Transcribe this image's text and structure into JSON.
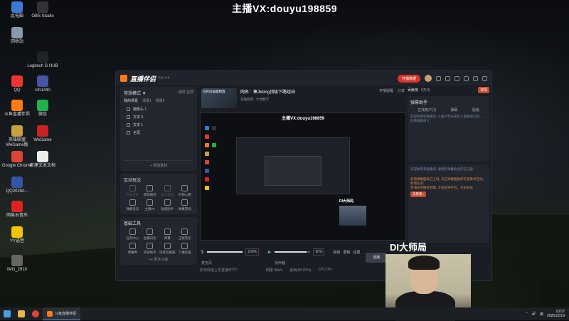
{
  "banner": "主播VX:douyu198859",
  "desktop_icons": [
    {
      "label": "此电脑",
      "color": "#3a7bd5"
    },
    {
      "label": "OBS Studio",
      "color": "#333333"
    },
    {
      "label": "回收站",
      "color": "#8899aa"
    },
    {
      "label": "Logitech G HUB",
      "color": "#222222"
    },
    {
      "label": "QQ",
      "color": "#e33"
    },
    {
      "label": "rsh1440",
      "color": "#4455aa"
    },
    {
      "label": "斗鱼直播伴侣",
      "color": "#ff7a18"
    },
    {
      "label": "微信",
      "color": "#22b14c"
    },
    {
      "label": "英雄联盟 WeGame版",
      "color": "#c9a040"
    },
    {
      "label": "WeGame",
      "color": "#cc2222"
    },
    {
      "label": "Google Chrome",
      "color": "#dd4433"
    },
    {
      "label": "新建文本文档",
      "color": "#eeeeee"
    },
    {
      "label": "QQ20250...",
      "color": "#3355aa"
    },
    {
      "label": "网易云音乐",
      "color": "#dd2222"
    },
    {
      "label": "YY语音",
      "color": "#f5c400"
    },
    {
      "label": "IMG_2910",
      "color": "#666666"
    }
  ],
  "app": {
    "name": "直播伴侣",
    "version": "5.5.4.4",
    "live_button": "开播数据",
    "left": {
      "mode_label": "常规模式 ▼",
      "mode_actions": [
        "横屏",
        "竖屏"
      ],
      "scene_tabs": [
        "我的场景",
        "场景1",
        "场景2"
      ],
      "sources": [
        "摄像头 1",
        "文本 3",
        "文本 1",
        "全屏"
      ],
      "add_source": "+ 添加素材",
      "interact_title": "互动玩法",
      "interact_items": [
        {
          "label": "点歌音乐",
          "dim": true
        },
        {
          "label": "模拟抽奖",
          "dim": false
        },
        {
          "label": "多人连麦",
          "dim": true
        },
        {
          "label": "礼物心愿",
          "dim": false
        },
        {
          "label": "弹幕玩法",
          "dim": false
        },
        {
          "label": "主播PK",
          "dim": false
        },
        {
          "label": "贴纸助手",
          "dim": false
        },
        {
          "label": "弹幕游戏",
          "dim": false
        }
      ],
      "tools_title": "基础工具",
      "tools_items": [
        {
          "label": "任务中心"
        },
        {
          "label": "直播日历"
        },
        {
          "label": "弹幕"
        },
        {
          "label": "正版音乐"
        },
        {
          "label": "弹幕秀"
        },
        {
          "label": "房管助手"
        },
        {
          "label": "场景切换器"
        },
        {
          "label": "下播检查"
        }
      ],
      "more": "••• 更多功能"
    },
    "stream": {
      "thumb_text": "已开启画面粗直",
      "title": "网名：寒Jkking顶级下路组站",
      "subtitle": "英雄联盟 - 大师数学",
      "right": [
        "开播提醒",
        "分享"
      ],
      "stats": [
        "全玩家",
        "星的列表",
        "4",
        "0"
      ]
    },
    "preview_banner": "主播VX:douyu198859",
    "preview_cam_label": "DI大师局",
    "audio": {
      "mic_label": "麦克风",
      "mic_value": "100%",
      "mic_fill": 1.0,
      "speaker_label": "扬声器",
      "speaker_value": "90%",
      "speaker_fill": 0.9,
      "actions": [
        "高级",
        "录制",
        "设置"
      ]
    },
    "status": [
      "如何快速上手直播环节?",
      "网络 0kb/s",
      "丢帧(00.00%)",
      "CPU 3%",
      "内存"
    ],
    "right": {
      "tabs": [
        "贡献榜",
        "0万元"
      ],
      "badge": "详情",
      "danmu_title": "弹幕助手",
      "danmu_tabs": [
        "在线用户(1)",
        "弹幕",
        "贴纸"
      ],
      "hint1": "欢迎你来到直播间, 斗鱼严禁未成年人直播或打赏。...",
      "hint2": "礼物贡献值 0",
      "hint3": "欢迎你来到直播间, 收到的弹幕会显示在这里...",
      "hint4": "新增弹幕面板已上线, 点击弹幕面板即可查看并互动。新增任务:",
      "hint5": "星海任务推荐领取, 斗鱼星海平台。点击前往",
      "link": "去看看 ›"
    },
    "connect": "连播"
  },
  "cam_overlay_label": "DI大师局",
  "taskbar": {
    "app_label": "斗鱼直播伴侣",
    "tray": [
      "英"
    ],
    "time": "10:07",
    "date": "2025/12/19"
  }
}
